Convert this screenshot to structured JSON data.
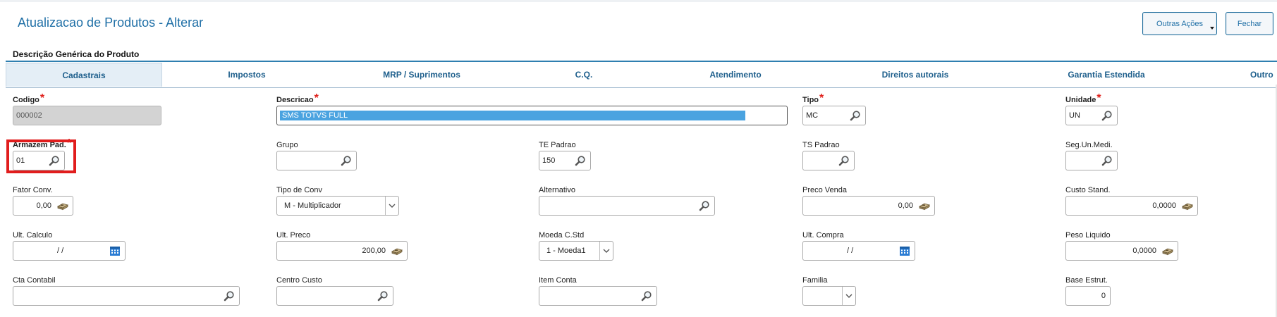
{
  "window": {
    "title": "Atualizacao de Produtos - Alterar",
    "buttons": {
      "outras_acoes": "Outras Ações",
      "fechar": "Fechar"
    }
  },
  "section": {
    "title": "Descrição Genérica do Produto"
  },
  "tabs": [
    {
      "label": "Cadastrais",
      "active": true
    },
    {
      "label": "Impostos"
    },
    {
      "label": "MRP / Suprimentos"
    },
    {
      "label": "C.Q."
    },
    {
      "label": "Atendimento"
    },
    {
      "label": "Direitos autorais"
    },
    {
      "label": "Garantia Estendida"
    },
    {
      "label": "Outro"
    }
  ],
  "required_mark": "*",
  "fields": {
    "codigo": {
      "label": "Codigo",
      "value": "000002",
      "required": true,
      "disabled": true
    },
    "descricao": {
      "label": "Descricao",
      "value": "SMS TOTVS FULL",
      "required": true
    },
    "tipo": {
      "label": "Tipo",
      "value": "MC",
      "required": true,
      "icon": "search-icon"
    },
    "unidade": {
      "label": "Unidade",
      "value": "UN",
      "required": true,
      "icon": "search-icon"
    },
    "armazem_pad": {
      "label": "Armazem Pad.",
      "value": "01",
      "required": true,
      "icon": "search-icon"
    },
    "grupo": {
      "label": "Grupo",
      "value": "",
      "icon": "search-icon"
    },
    "te_padrao": {
      "label": "TE Padrao",
      "value": "150",
      "icon": "search-icon"
    },
    "ts_padrao": {
      "label": "TS Padrao",
      "value": "",
      "icon": "search-icon"
    },
    "seg_un_medi": {
      "label": "Seg.Un.Medi.",
      "value": "",
      "icon": "search-icon"
    },
    "fator_conv": {
      "label": "Fator Conv.",
      "value": "0,00",
      "icon": "calculator-icon"
    },
    "tipo_de_conv": {
      "label": "Tipo de Conv",
      "value": "M - Multiplicador",
      "icon": "chevron-down-icon"
    },
    "alternativo": {
      "label": "Alternativo",
      "value": "",
      "icon": "search-icon"
    },
    "preco_venda": {
      "label": "Preco Venda",
      "value": "0,00",
      "icon": "calculator-icon"
    },
    "custo_stand": {
      "label": "Custo Stand.",
      "value": "0,0000",
      "icon": "calculator-icon"
    },
    "ult_calculo": {
      "label": "Ult. Calculo",
      "value": "/ /",
      "icon": "calendar-icon"
    },
    "ult_preco": {
      "label": "Ult. Preco",
      "value": "200,00",
      "icon": "calculator-icon"
    },
    "moeda_c_std": {
      "label": "Moeda C.Std",
      "value": "1 - Moeda1",
      "icon": "chevron-down-icon"
    },
    "ult_compra": {
      "label": "Ult. Compra",
      "value": "/ /",
      "icon": "calendar-icon"
    },
    "peso_liquido": {
      "label": "Peso Liquido",
      "value": "0,0000",
      "icon": "calculator-icon"
    },
    "cta_contabil": {
      "label": "Cta Contabil",
      "value": "",
      "icon": "search-icon"
    },
    "centro_custo": {
      "label": "Centro Custo",
      "value": "",
      "icon": "search-icon"
    },
    "item_conta": {
      "label": "Item Conta",
      "value": "",
      "icon": "search-icon"
    },
    "familia": {
      "label": "Familia",
      "value": "",
      "icon": "chevron-down-icon"
    },
    "base_estrut": {
      "label": "Base Estrut.",
      "value": "0"
    }
  },
  "colors": {
    "title": "#1f6fa6",
    "accent": "#2f7fb0",
    "required": "#e0201b",
    "highlight_border": "#e11d1d",
    "selection": "#4aa3e0"
  }
}
